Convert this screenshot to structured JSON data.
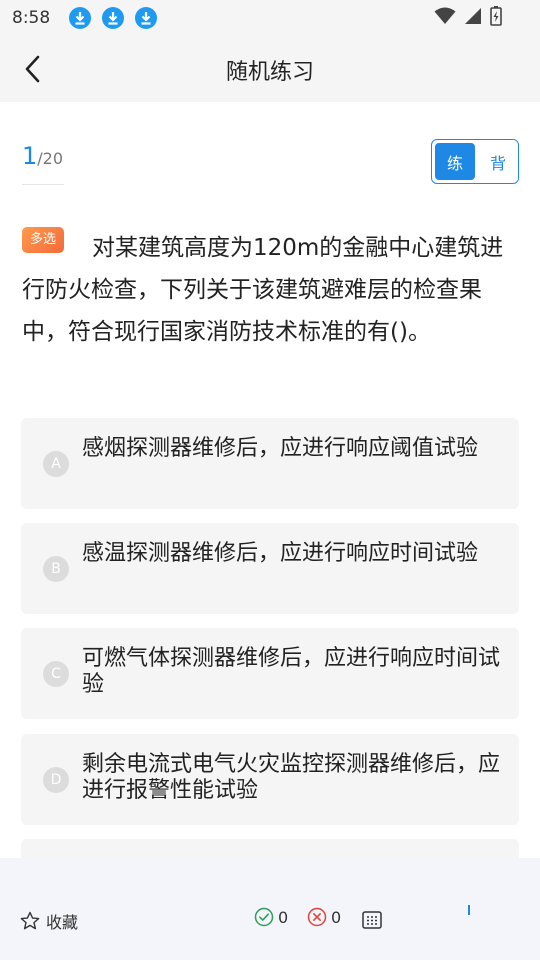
{
  "status": {
    "time": "8:58"
  },
  "header": {
    "title": "随机练习"
  },
  "progress": {
    "current": "1",
    "total": "/20"
  },
  "mode": {
    "practice": "练",
    "recite": "背"
  },
  "question": {
    "type": "多选",
    "text": "对某建筑高度为120m的金融中心建筑进行防火检查，下列关于该建筑避难层的检查果中，符合现行国家消防技术标准的有()。"
  },
  "options": [
    {
      "letter": "A",
      "text": "感烟探测器维修后，应进行响应阈值试验"
    },
    {
      "letter": "B",
      "text": "感温探测器维修后，应进行响应时间试验"
    },
    {
      "letter": "C",
      "text": "可燃气体探测器维修后，应进行响应时间试验"
    },
    {
      "letter": "D",
      "text": "剩余电流式电气火灾监控探测器维修后，应进行报警性能试验"
    }
  ],
  "bottom": {
    "favorite": "收藏",
    "correct_count": "0",
    "wrong_count": "0"
  },
  "colors": {
    "accent": "#1e88e5",
    "badge": "#f36a3a",
    "correct": "#2e9e5a",
    "wrong": "#e0453a"
  }
}
